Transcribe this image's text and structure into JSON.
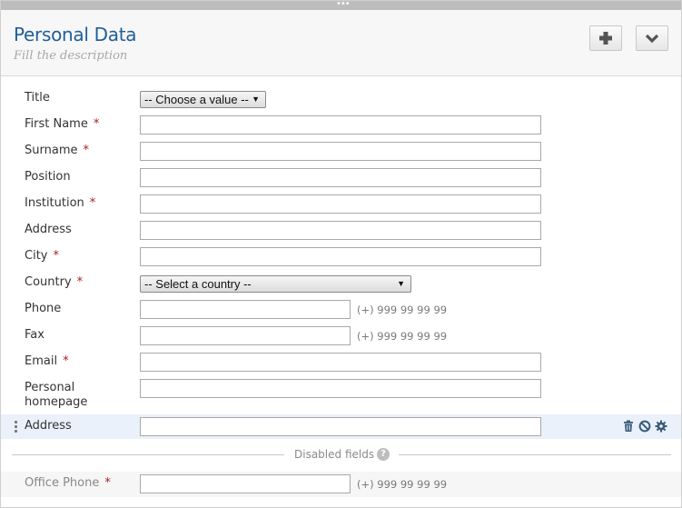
{
  "header": {
    "title": "Personal Data",
    "subtitle": "Fill the description",
    "add_icon": "plus-icon",
    "collapse_icon": "chevron-down-icon"
  },
  "colors": {
    "title": "#1f5f99",
    "required": "#b01c1c",
    "highlight_row": "#eaf1fa"
  },
  "fields": {
    "title": {
      "label": "Title",
      "value": "-- Choose a value --"
    },
    "first_name": {
      "label": "First Name",
      "required": "*",
      "value": ""
    },
    "surname": {
      "label": "Surname",
      "required": "*",
      "value": ""
    },
    "position": {
      "label": "Position",
      "value": ""
    },
    "institution": {
      "label": "Institution",
      "required": "*",
      "value": ""
    },
    "address": {
      "label": "Address",
      "value": ""
    },
    "city": {
      "label": "City",
      "required": "*",
      "value": ""
    },
    "country": {
      "label": "Country",
      "required": "*",
      "value": "-- Select a country --"
    },
    "phone": {
      "label": "Phone",
      "value": "",
      "hint": "(+) 999 99 99 99"
    },
    "fax": {
      "label": "Fax",
      "value": "",
      "hint": "(+) 999 99 99 99"
    },
    "email": {
      "label": "Email",
      "required": "*",
      "value": ""
    },
    "homepage": {
      "label_line1": "Personal",
      "label_line2": "homepage",
      "value": ""
    },
    "address2": {
      "label": "Address",
      "value": "",
      "icons": [
        "trash-icon",
        "ban-icon",
        "gear-icon"
      ]
    }
  },
  "disabled_section": {
    "label": "Disabled fields",
    "help_icon": "question-icon",
    "help_glyph": "?",
    "office_phone": {
      "label": "Office Phone",
      "required": "*",
      "value": "",
      "hint": "(+) 999 99 99 99"
    }
  }
}
